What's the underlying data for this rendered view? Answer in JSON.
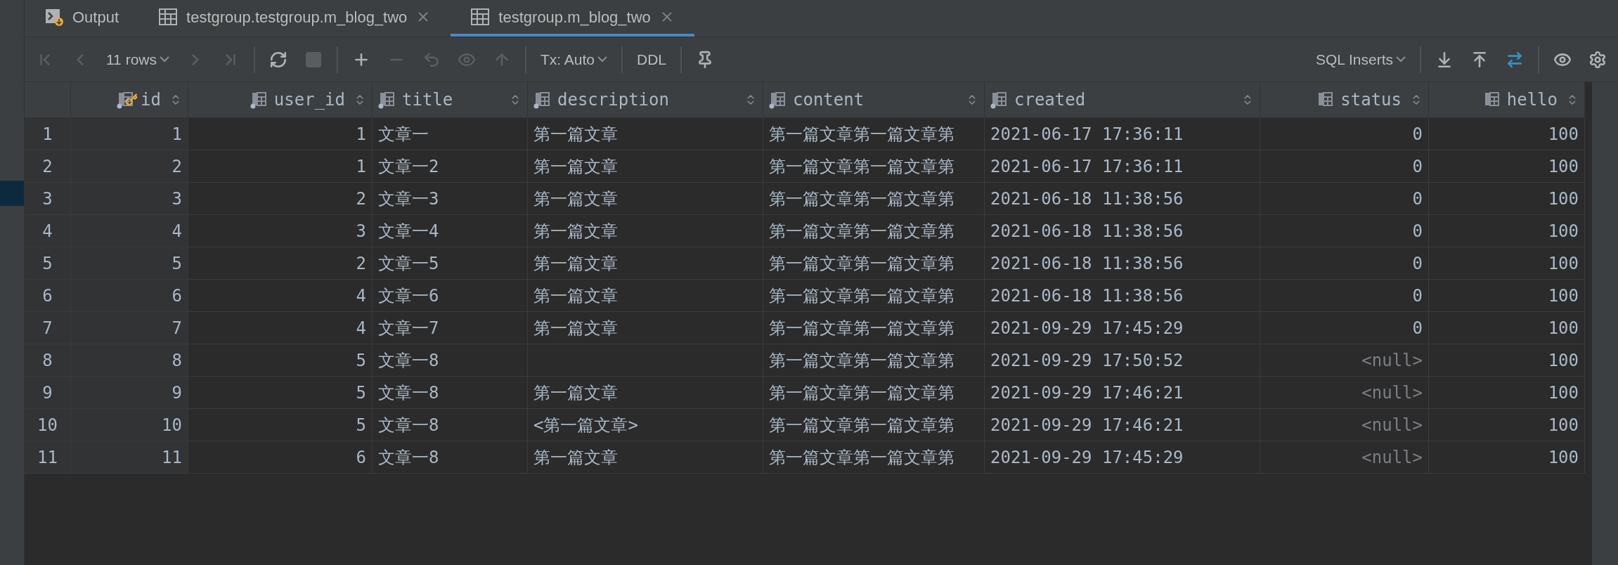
{
  "tabs": [
    {
      "label": "Output",
      "kind": "output",
      "closable": false,
      "selected": false
    },
    {
      "label": "testgroup.testgroup.m_blog_two",
      "kind": "table",
      "closable": true,
      "selected": false
    },
    {
      "label": "testgroup.m_blog_two",
      "kind": "table",
      "closable": true,
      "selected": true
    }
  ],
  "toolbar": {
    "left": [
      {
        "kind": "first",
        "disabled": true
      },
      {
        "kind": "prev",
        "disabled": true
      },
      {
        "kind": "dropdown",
        "label": "11 rows"
      },
      {
        "kind": "next",
        "disabled": true
      },
      {
        "kind": "last",
        "disabled": true
      },
      {
        "kind": "separator"
      },
      {
        "kind": "refresh",
        "disabled": false
      },
      {
        "kind": "stop",
        "disabled": true
      },
      {
        "kind": "separator"
      },
      {
        "kind": "add",
        "disabled": false
      },
      {
        "kind": "remove",
        "disabled": true
      },
      {
        "kind": "undo",
        "disabled": true
      },
      {
        "kind": "preview",
        "disabled": true
      },
      {
        "kind": "submit",
        "disabled": true
      },
      {
        "kind": "separator"
      },
      {
        "kind": "dropdown",
        "label": "Tx: Auto"
      },
      {
        "kind": "separator"
      },
      {
        "kind": "text",
        "label": "DDL"
      },
      {
        "kind": "separator"
      },
      {
        "kind": "pin",
        "disabled": false
      }
    ],
    "right": [
      {
        "kind": "dropdown",
        "label": "SQL Inserts"
      },
      {
        "kind": "separator"
      },
      {
        "kind": "export",
        "disabled": false
      },
      {
        "kind": "import",
        "disabled": false
      },
      {
        "kind": "compare",
        "disabled": false
      },
      {
        "kind": "separator"
      },
      {
        "kind": "view",
        "disabled": false
      },
      {
        "kind": "settings",
        "disabled": false
      }
    ]
  },
  "table": {
    "columns": [
      {
        "name": "id",
        "primary_key": true,
        "dot": true,
        "kind": "number"
      },
      {
        "name": "user_id",
        "primary_key": false,
        "dot": true,
        "kind": "number"
      },
      {
        "name": "title",
        "primary_key": false,
        "dot": true,
        "kind": "text"
      },
      {
        "name": "description",
        "primary_key": false,
        "dot": true,
        "kind": "text"
      },
      {
        "name": "content",
        "primary_key": false,
        "dot": true,
        "kind": "text"
      },
      {
        "name": "created",
        "primary_key": false,
        "dot": true,
        "kind": "text"
      },
      {
        "name": "status",
        "primary_key": false,
        "dot": false,
        "kind": "number"
      },
      {
        "name": "hello",
        "primary_key": false,
        "dot": false,
        "kind": "number"
      }
    ],
    "rows": [
      {
        "number": "1",
        "cells": [
          {
            "value": "1"
          },
          {
            "value": "1"
          },
          {
            "value": "文章一"
          },
          {
            "value": "第一篇文章"
          },
          {
            "value": "第一篇文章第一篇文章第"
          },
          {
            "value": "2021-06-17 17:36:11"
          },
          {
            "value": "0"
          },
          {
            "value": "100"
          }
        ]
      },
      {
        "number": "2",
        "cells": [
          {
            "value": "2"
          },
          {
            "value": "1"
          },
          {
            "value": "文章一2"
          },
          {
            "value": "第一篇文章"
          },
          {
            "value": "第一篇文章第一篇文章第"
          },
          {
            "value": "2021-06-17 17:36:11"
          },
          {
            "value": "0"
          },
          {
            "value": "100"
          }
        ]
      },
      {
        "number": "3",
        "cells": [
          {
            "value": "3"
          },
          {
            "value": "2"
          },
          {
            "value": "文章一3"
          },
          {
            "value": "第一篇文章"
          },
          {
            "value": "第一篇文章第一篇文章第"
          },
          {
            "value": "2021-06-18 11:38:56"
          },
          {
            "value": "0"
          },
          {
            "value": "100"
          }
        ]
      },
      {
        "number": "4",
        "cells": [
          {
            "value": "4"
          },
          {
            "value": "3"
          },
          {
            "value": "文章一4"
          },
          {
            "value": "第一篇文章"
          },
          {
            "value": "第一篇文章第一篇文章第"
          },
          {
            "value": "2021-06-18 11:38:56"
          },
          {
            "value": "0"
          },
          {
            "value": "100"
          }
        ]
      },
      {
        "number": "5",
        "cells": [
          {
            "value": "5"
          },
          {
            "value": "2"
          },
          {
            "value": "文章一5"
          },
          {
            "value": "第一篇文章"
          },
          {
            "value": "第一篇文章第一篇文章第"
          },
          {
            "value": "2021-06-18 11:38:56"
          },
          {
            "value": "0"
          },
          {
            "value": "100"
          }
        ]
      },
      {
        "number": "6",
        "cells": [
          {
            "value": "6"
          },
          {
            "value": "4"
          },
          {
            "value": "文章一6"
          },
          {
            "value": "第一篇文章"
          },
          {
            "value": "第一篇文章第一篇文章第"
          },
          {
            "value": "2021-06-18 11:38:56"
          },
          {
            "value": "0"
          },
          {
            "value": "100"
          }
        ]
      },
      {
        "number": "7",
        "cells": [
          {
            "value": "7"
          },
          {
            "value": "4"
          },
          {
            "value": "文章一7"
          },
          {
            "value": "第一篇文章"
          },
          {
            "value": "第一篇文章第一篇文章第"
          },
          {
            "value": "2021-09-29 17:45:29"
          },
          {
            "value": "0"
          },
          {
            "value": "100"
          }
        ]
      },
      {
        "number": "8",
        "cells": [
          {
            "value": "8"
          },
          {
            "value": "5"
          },
          {
            "value": "文章一8"
          },
          {},
          {
            "value": "第一篇文章第一篇文章第"
          },
          {
            "value": "2021-09-29 17:50:52"
          },
          {
            "value": "<null>",
            "is_null": true
          },
          {
            "value": "100"
          }
        ]
      },
      {
        "number": "9",
        "cells": [
          {
            "value": "9"
          },
          {
            "value": "5"
          },
          {
            "value": "文章一8"
          },
          {
            "value": "第一篇文章"
          },
          {
            "value": "第一篇文章第一篇文章第"
          },
          {
            "value": "2021-09-29 17:46:21"
          },
          {
            "value": "<null>",
            "is_null": true
          },
          {
            "value": "100"
          }
        ]
      },
      {
        "number": "10",
        "cells": [
          {
            "value": "10"
          },
          {
            "value": "5"
          },
          {
            "value": "文章一8"
          },
          {
            "value": "<第一篇文章>"
          },
          {
            "value": "第一篇文章第一篇文章第"
          },
          {
            "value": "2021-09-29 17:46:21"
          },
          {
            "value": "<null>",
            "is_null": true
          },
          {
            "value": "100"
          }
        ]
      },
      {
        "number": "11",
        "cells": [
          {
            "value": "11"
          },
          {
            "value": "6"
          },
          {
            "value": "文章一8"
          },
          {
            "value": "第一篇文章"
          },
          {
            "value": "第一篇文章第一篇文章第"
          },
          {
            "value": "2021-09-29 17:45:29"
          },
          {
            "value": "<null>",
            "is_null": true
          },
          {
            "value": "100"
          }
        ]
      }
    ]
  }
}
